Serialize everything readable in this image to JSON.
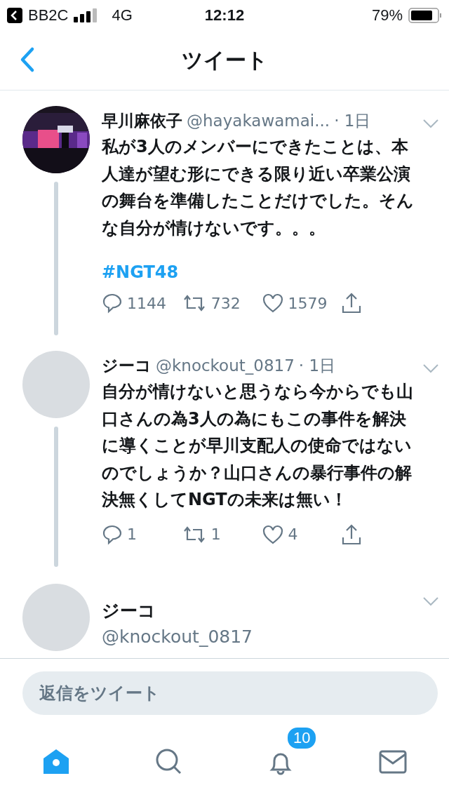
{
  "status_bar": {
    "back_app": "BB2C",
    "network": "4G",
    "time": "12:12",
    "battery": "79%"
  },
  "header": {
    "title": "ツイート"
  },
  "tweets": [
    {
      "kind": "full",
      "name": "早川麻依子",
      "handle": "@hayakawamai...",
      "time": "· 1日",
      "body": "私が3人のメンバーにできたことは、本人達が望む形にできる限り近い卒業公演の舞台を準備したことだけでした。そんな自分が情けないです。。。",
      "hashtag": "#NGT48",
      "replies": "1144",
      "retweets": "732",
      "likes": "1579",
      "thread": true
    },
    {
      "kind": "full",
      "avatar": {
        "kind": "plain"
      },
      "name": "ジーコ",
      "handle": "@knockout_0817",
      "time": "· 1日",
      "body": "自分が情けないと思うなら今からでも山口さんの為3人の為にもこの事件を解決に導くことが早川支配人の使命ではないのでしょうか？山口さんの暴行事件の解決無くしてNGTの未来は無い！",
      "replies": "1",
      "retweets": "1",
      "likes": "4",
      "thread": true
    },
    {
      "kind": "focus",
      "avatar": {
        "kind": "plain"
      },
      "name": "ジーコ",
      "handle": "@knockout_0817",
      "thread": false
    }
  ],
  "reply_field": {
    "placeholder": "返信をツイート"
  },
  "tab_bar": [
    {
      "kind": "home",
      "selected": true
    },
    {
      "kind": "search",
      "selected": false
    },
    {
      "kind": "notifications",
      "selected": false,
      "badge": "10"
    },
    {
      "kind": "messages",
      "selected": false
    }
  ]
}
